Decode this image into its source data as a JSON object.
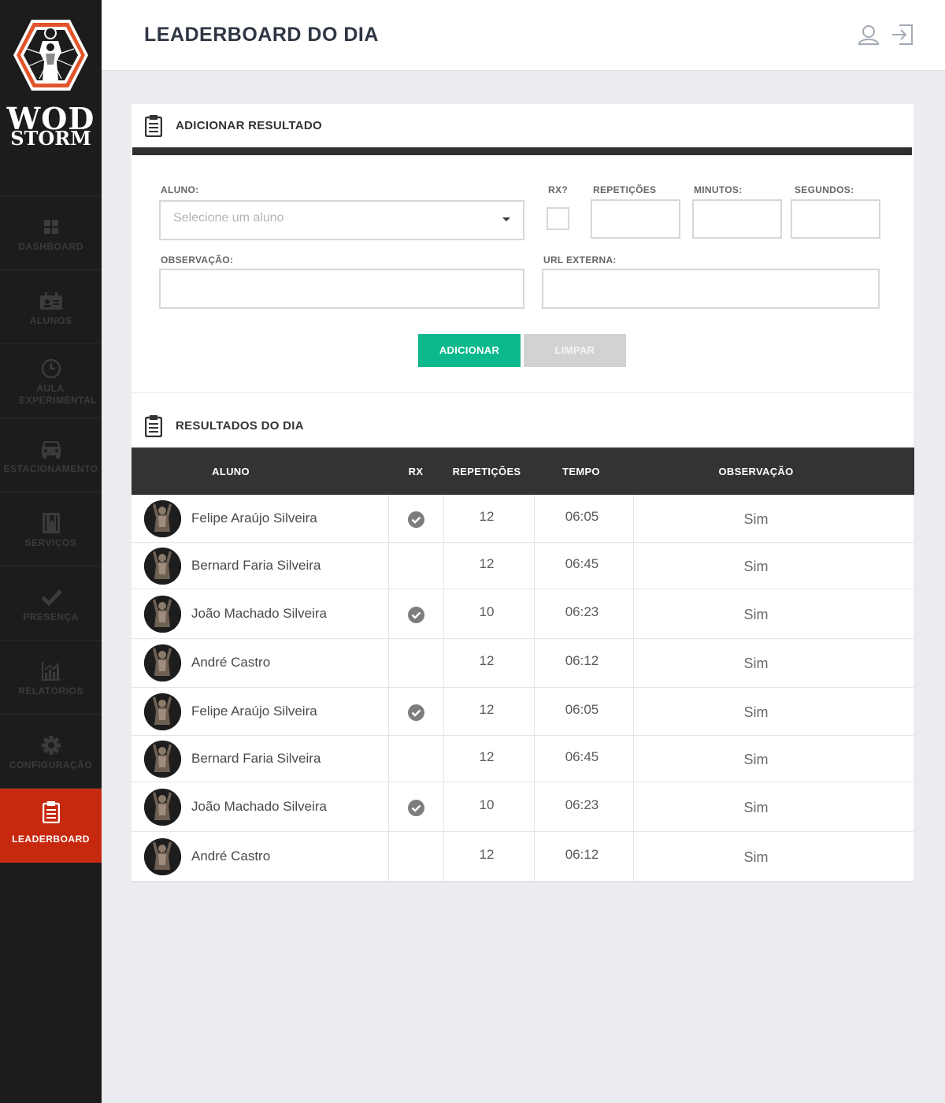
{
  "brand": {
    "line1": "WOD",
    "line2": "STORM"
  },
  "sidebar": {
    "items": [
      {
        "label": "DASHBOARD",
        "icon": "grid-icon"
      },
      {
        "label": "ALUNOS",
        "icon": "id-card-icon"
      },
      {
        "label": "AULA EXPERIMENTAL",
        "icon": "clock-icon"
      },
      {
        "label": "ESTACIONAMENTO",
        "icon": "car-icon"
      },
      {
        "label": "SERVIÇOS",
        "icon": "book-icon"
      },
      {
        "label": "PRESENÇA",
        "icon": "checkmark-icon"
      },
      {
        "label": "RELATÓRIOS",
        "icon": "chart-icon"
      },
      {
        "label": "CONFIGURAÇÃO",
        "icon": "gear-icon"
      },
      {
        "label": "LEADERBOARD",
        "icon": "clipboard-icon",
        "active": true
      }
    ]
  },
  "header": {
    "title": "LEADERBOARD DO DIA",
    "icons": [
      "user-icon",
      "logout-icon"
    ]
  },
  "form": {
    "title": "ADICIONAR RESULTADO",
    "aluno_label": "ALUNO:",
    "aluno_placeholder": "Selecione um aluno",
    "rx_label": "RX?",
    "repeticoes_label": "REPETIÇÕES",
    "minutos_label": "MINUTOS:",
    "segundos_label": "SEGUNDOS:",
    "observacao_label": "OBSERVAÇÃO:",
    "url_label": "URL EXTERNA:",
    "add_button": "ADICIONAR",
    "clear_button": "LIMPAR"
  },
  "results": {
    "title": "RESULTADOS DO DIA",
    "columns": [
      "ALUNO",
      "RX",
      "REPETIÇÕES",
      "TEMPO",
      "OBSERVAÇÃO"
    ],
    "rows": [
      {
        "name": "Felipe Araújo Silveira",
        "rx": true,
        "reps": "12",
        "time": "06:05",
        "obs": "Sim"
      },
      {
        "name": "Bernard Faria Silveira",
        "rx": false,
        "reps": "12",
        "time": "06:45",
        "obs": "Sim"
      },
      {
        "name": "João Machado Silveira",
        "rx": true,
        "reps": "10",
        "time": "06:23",
        "obs": "Sim"
      },
      {
        "name": "André Castro",
        "rx": false,
        "reps": "12",
        "time": "06:12",
        "obs": "Sim"
      },
      {
        "name": "Felipe Araújo Silveira",
        "rx": true,
        "reps": "12",
        "time": "06:05",
        "obs": "Sim"
      },
      {
        "name": "Bernard Faria Silveira",
        "rx": false,
        "reps": "12",
        "time": "06:45",
        "obs": "Sim"
      },
      {
        "name": "João Machado Silveira",
        "rx": true,
        "reps": "10",
        "time": "06:23",
        "obs": "Sim"
      },
      {
        "name": "André Castro",
        "rx": false,
        "reps": "12",
        "time": "06:12",
        "obs": "Sim"
      }
    ]
  },
  "colors": {
    "accent": "#c7290f",
    "add_button": "#0bb98c",
    "sidebar": "#1c1c1c"
  }
}
